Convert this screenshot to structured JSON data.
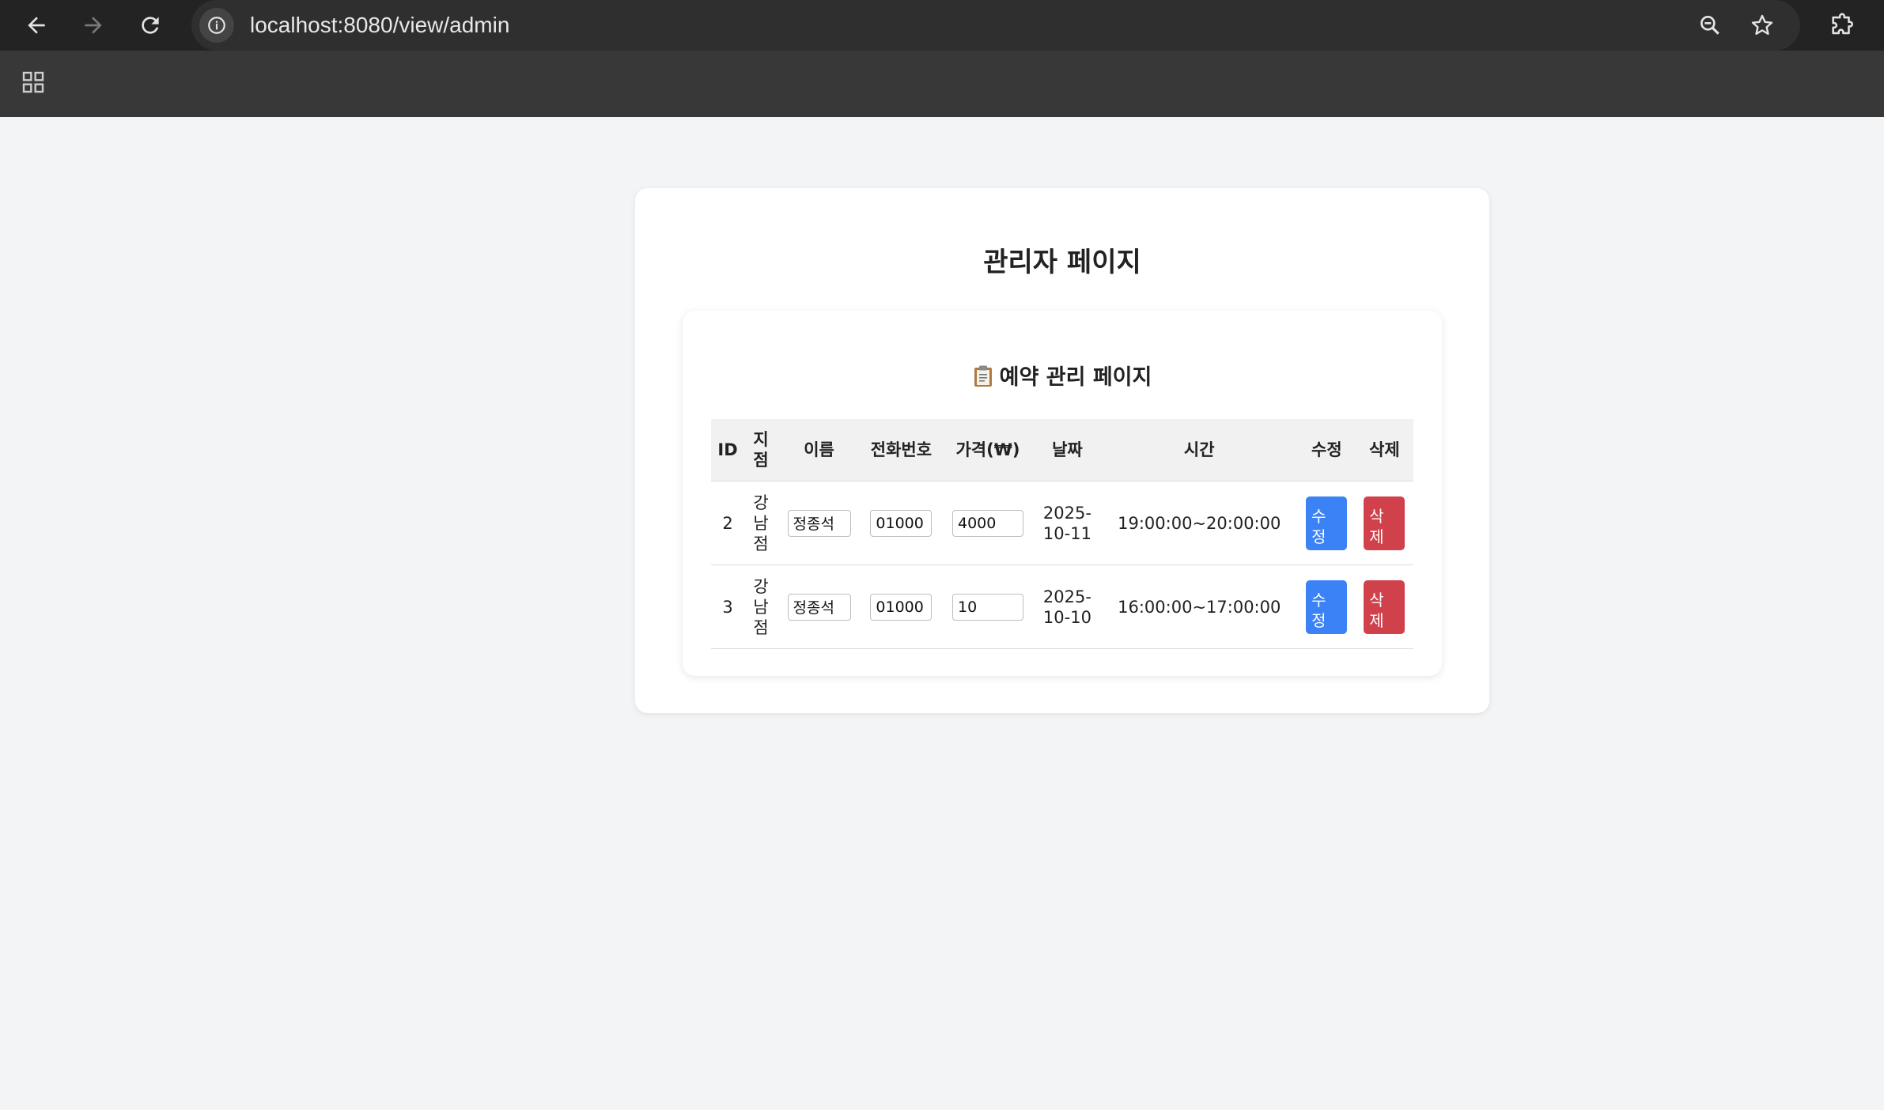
{
  "browser": {
    "url": "localhost:8080/view/admin"
  },
  "page": {
    "title": "관리자 페이지",
    "section_title": "예약 관리 페이지"
  },
  "table": {
    "headers": {
      "id": "ID",
      "branch": "지점",
      "name": "이름",
      "phone": "전화번호",
      "price": "가격(₩)",
      "date": "날짜",
      "time": "시간",
      "edit": "수정",
      "delete": "삭제"
    },
    "rows": [
      {
        "id": "2",
        "branch": "강남점",
        "name": "정종석",
        "phone": "01000",
        "price": "4000",
        "date": "2025-10-11",
        "time": "19:00:00~20:00:00",
        "edit_label": "수정",
        "delete_label": "삭제"
      },
      {
        "id": "3",
        "branch": "강남점",
        "name": "정종석",
        "phone": "01000",
        "price": "10",
        "date": "2025-10-10",
        "time": "16:00:00~17:00:00",
        "edit_label": "수정",
        "delete_label": "삭제"
      }
    ]
  },
  "colors": {
    "edit_button": "#3b82f6",
    "delete_button": "#d0414b",
    "page_background": "#f3f4f6"
  }
}
